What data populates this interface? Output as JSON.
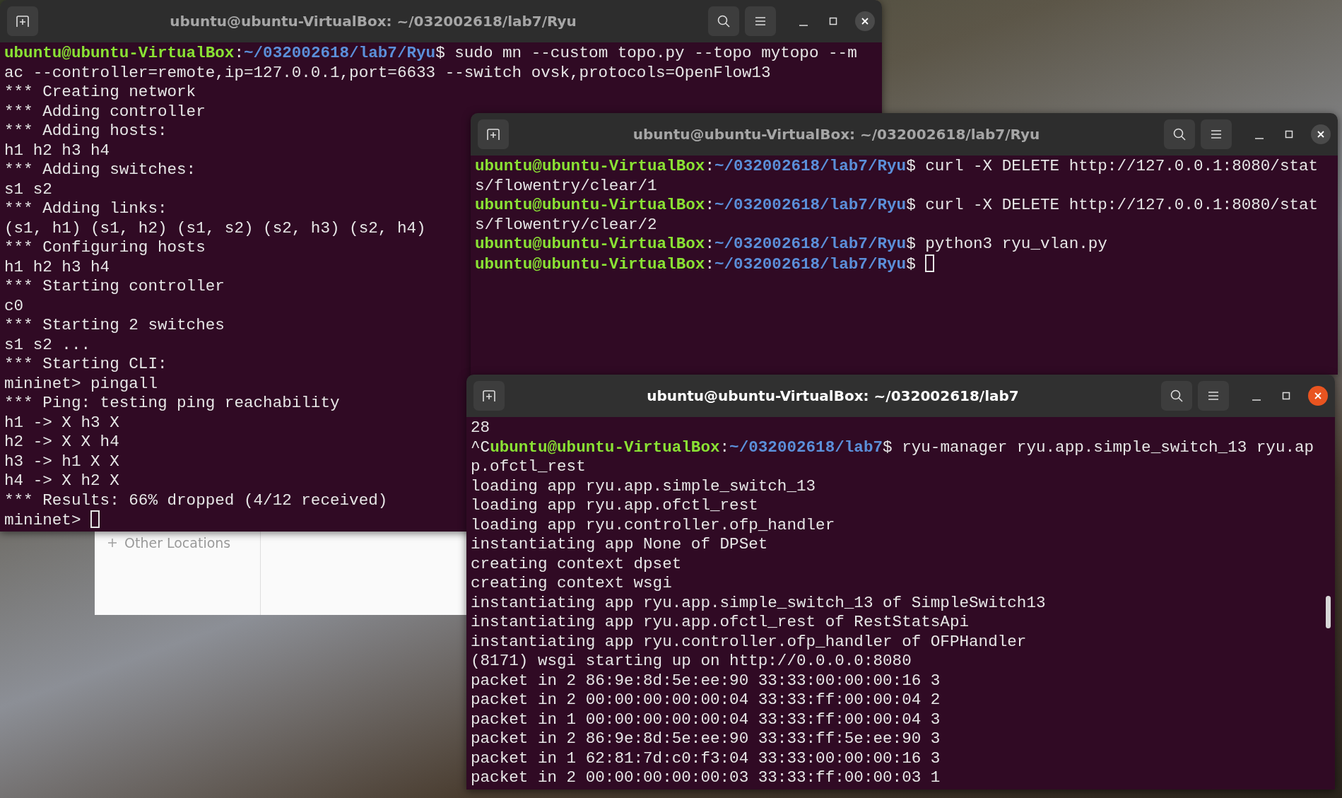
{
  "file_manager": {
    "sidebar_items": [
      {
        "label": "Other Locations"
      }
    ]
  },
  "windows": [
    {
      "title": "ubuntu@ubuntu-VirtualBox: ~/032002618/lab7/Ryu",
      "focused": false,
      "lines": [
        [
          {
            "kind": "user",
            "text": "ubuntu@ubuntu-VirtualBox"
          },
          {
            "kind": "text",
            "text": ":"
          },
          {
            "kind": "path",
            "text": "~/032002618/lab7/Ryu"
          },
          {
            "kind": "text",
            "text": "$ sudo mn --custom topo.py --topo mytopo --m"
          }
        ],
        [
          {
            "kind": "text",
            "text": "ac --controller=remote,ip=127.0.0.1,port=6633 --switch ovsk,protocols=OpenFlow13"
          }
        ],
        [
          {
            "kind": "text",
            "text": "*** Creating network"
          }
        ],
        [
          {
            "kind": "text",
            "text": "*** Adding controller"
          }
        ],
        [
          {
            "kind": "text",
            "text": "*** Adding hosts:"
          }
        ],
        [
          {
            "kind": "text",
            "text": "h1 h2 h3 h4"
          }
        ],
        [
          {
            "kind": "text",
            "text": "*** Adding switches:"
          }
        ],
        [
          {
            "kind": "text",
            "text": "s1 s2"
          }
        ],
        [
          {
            "kind": "text",
            "text": "*** Adding links:"
          }
        ],
        [
          {
            "kind": "text",
            "text": "(s1, h1) (s1, h2) (s1, s2) (s2, h3) (s2, h4)"
          }
        ],
        [
          {
            "kind": "text",
            "text": "*** Configuring hosts"
          }
        ],
        [
          {
            "kind": "text",
            "text": "h1 h2 h3 h4"
          }
        ],
        [
          {
            "kind": "text",
            "text": "*** Starting controller"
          }
        ],
        [
          {
            "kind": "text",
            "text": "c0"
          }
        ],
        [
          {
            "kind": "text",
            "text": "*** Starting 2 switches"
          }
        ],
        [
          {
            "kind": "text",
            "text": "s1 s2 ..."
          }
        ],
        [
          {
            "kind": "text",
            "text": "*** Starting CLI:"
          }
        ],
        [
          {
            "kind": "text",
            "text": "mininet> pingall"
          }
        ],
        [
          {
            "kind": "text",
            "text": "*** Ping: testing ping reachability"
          }
        ],
        [
          {
            "kind": "text",
            "text": "h1 -> X h3 X"
          }
        ],
        [
          {
            "kind": "text",
            "text": "h2 -> X X h4"
          }
        ],
        [
          {
            "kind": "text",
            "text": "h3 -> h1 X X"
          }
        ],
        [
          {
            "kind": "text",
            "text": "h4 -> X h2 X"
          }
        ],
        [
          {
            "kind": "text",
            "text": "*** Results: 66% dropped (4/12 received)"
          }
        ],
        [
          {
            "kind": "text",
            "text": "mininet> "
          },
          {
            "kind": "cursor"
          }
        ]
      ]
    },
    {
      "title": "ubuntu@ubuntu-VirtualBox: ~/032002618/lab7/Ryu",
      "focused": false,
      "lines": [
        [
          {
            "kind": "user",
            "text": "ubuntu@ubuntu-VirtualBox"
          },
          {
            "kind": "text",
            "text": ":"
          },
          {
            "kind": "path",
            "text": "~/032002618/lab7/Ryu"
          },
          {
            "kind": "text",
            "text": "$ curl -X DELETE http://127.0.0.1:8080/stat"
          }
        ],
        [
          {
            "kind": "text",
            "text": "s/flowentry/clear/1"
          }
        ],
        [
          {
            "kind": "user",
            "text": "ubuntu@ubuntu-VirtualBox"
          },
          {
            "kind": "text",
            "text": ":"
          },
          {
            "kind": "path",
            "text": "~/032002618/lab7/Ryu"
          },
          {
            "kind": "text",
            "text": "$ curl -X DELETE http://127.0.0.1:8080/stat"
          }
        ],
        [
          {
            "kind": "text",
            "text": "s/flowentry/clear/2"
          }
        ],
        [
          {
            "kind": "user",
            "text": "ubuntu@ubuntu-VirtualBox"
          },
          {
            "kind": "text",
            "text": ":"
          },
          {
            "kind": "path",
            "text": "~/032002618/lab7/Ryu"
          },
          {
            "kind": "text",
            "text": "$ python3 ryu_vlan.py"
          }
        ],
        [
          {
            "kind": "user",
            "text": "ubuntu@ubuntu-VirtualBox"
          },
          {
            "kind": "text",
            "text": ":"
          },
          {
            "kind": "path",
            "text": "~/032002618/lab7/Ryu"
          },
          {
            "kind": "text",
            "text": "$ "
          },
          {
            "kind": "cursor"
          }
        ]
      ]
    },
    {
      "title": "ubuntu@ubuntu-VirtualBox: ~/032002618/lab7",
      "focused": true,
      "lines": [
        [
          {
            "kind": "text",
            "text": "28"
          }
        ],
        [
          {
            "kind": "text",
            "text": "^C"
          },
          {
            "kind": "user",
            "text": "ubuntu@ubuntu-VirtualBox"
          },
          {
            "kind": "text",
            "text": ":"
          },
          {
            "kind": "path",
            "text": "~/032002618/lab7"
          },
          {
            "kind": "text",
            "text": "$ ryu-manager ryu.app.simple_switch_13 ryu.ap"
          }
        ],
        [
          {
            "kind": "text",
            "text": "p.ofctl_rest"
          }
        ],
        [
          {
            "kind": "text",
            "text": "loading app ryu.app.simple_switch_13"
          }
        ],
        [
          {
            "kind": "text",
            "text": "loading app ryu.app.ofctl_rest"
          }
        ],
        [
          {
            "kind": "text",
            "text": "loading app ryu.controller.ofp_handler"
          }
        ],
        [
          {
            "kind": "text",
            "text": "instantiating app None of DPSet"
          }
        ],
        [
          {
            "kind": "text",
            "text": "creating context dpset"
          }
        ],
        [
          {
            "kind": "text",
            "text": "creating context wsgi"
          }
        ],
        [
          {
            "kind": "text",
            "text": "instantiating app ryu.app.simple_switch_13 of SimpleSwitch13"
          }
        ],
        [
          {
            "kind": "text",
            "text": "instantiating app ryu.app.ofctl_rest of RestStatsApi"
          }
        ],
        [
          {
            "kind": "text",
            "text": "instantiating app ryu.controller.ofp_handler of OFPHandler"
          }
        ],
        [
          {
            "kind": "text",
            "text": "(8171) wsgi starting up on http://0.0.0.0:8080"
          }
        ],
        [
          {
            "kind": "text",
            "text": "packet in 2 86:9e:8d:5e:ee:90 33:33:00:00:00:16 3"
          }
        ],
        [
          {
            "kind": "text",
            "text": "packet in 2 00:00:00:00:00:04 33:33:ff:00:00:04 2"
          }
        ],
        [
          {
            "kind": "text",
            "text": "packet in 1 00:00:00:00:00:04 33:33:ff:00:00:04 3"
          }
        ],
        [
          {
            "kind": "text",
            "text": "packet in 2 86:9e:8d:5e:ee:90 33:33:ff:5e:ee:90 3"
          }
        ],
        [
          {
            "kind": "text",
            "text": "packet in 1 62:81:7d:c0:f3:04 33:33:00:00:00:16 3"
          }
        ],
        [
          {
            "kind": "text",
            "text": "packet in 2 00:00:00:00:00:03 33:33:ff:00:00:03 1"
          }
        ]
      ]
    }
  ]
}
